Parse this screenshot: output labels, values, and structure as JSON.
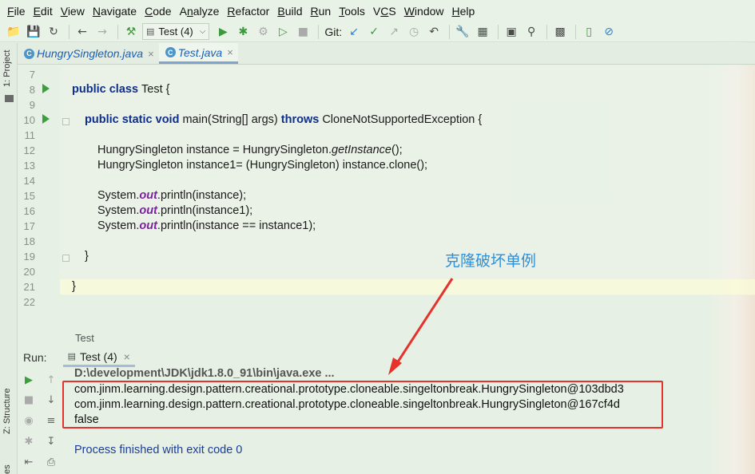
{
  "menu": {
    "items": [
      {
        "label": "File",
        "mnemonic_index": 0
      },
      {
        "label": "Edit",
        "mnemonic_index": 0
      },
      {
        "label": "View",
        "mnemonic_index": 0
      },
      {
        "label": "Navigate",
        "mnemonic_index": 0
      },
      {
        "label": "Code",
        "mnemonic_index": 0
      },
      {
        "label": "Analyze",
        "mnemonic_index": 1
      },
      {
        "label": "Refactor",
        "mnemonic_index": 0
      },
      {
        "label": "Build",
        "mnemonic_index": 0
      },
      {
        "label": "Run",
        "mnemonic_index": 0
      },
      {
        "label": "Tools",
        "mnemonic_index": 0
      },
      {
        "label": "VCS",
        "mnemonic_index": 1
      },
      {
        "label": "Window",
        "mnemonic_index": 0
      },
      {
        "label": "Help",
        "mnemonic_index": 0
      }
    ]
  },
  "toolbar": {
    "run_config": "Test (4)",
    "git_label": "Git:"
  },
  "side_tabs": {
    "project": "1: Project",
    "structure": "Z: Structure",
    "favorites": "es"
  },
  "editor_tabs": [
    {
      "file": "HungrySingleton.java",
      "icon": "C",
      "active": false
    },
    {
      "file": "Test.java",
      "icon": "C",
      "active": true
    }
  ],
  "editor": {
    "line_numbers": [
      "7",
      "8",
      "9",
      "10",
      "11",
      "12",
      "13",
      "14",
      "15",
      "16",
      "17",
      "18",
      "19",
      "20",
      "21",
      "22"
    ],
    "lines": {
      "l8_a": "public class ",
      "l8_b": "Test {",
      "l10_a": "public static void ",
      "l10_b": "main(String[] args) ",
      "l10_c": "throws ",
      "l10_d": "CloneNotSupportedException {",
      "l12_a": "HungrySingleton instance = HungrySingleton.",
      "l12_b": "getInstance",
      "l12_c": "();",
      "l13": "HungrySingleton instance1= (HungrySingleton) instance.clone();",
      "l15_a": "System.",
      "l15_b": "out",
      "l15_c": ".println(instance);",
      "l16_a": "System.",
      "l16_b": "out",
      "l16_c": ".println(instance1);",
      "l17_a": "System.",
      "l17_b": "out",
      "l17_c": ".println(instance == instance1);",
      "l19": "}",
      "l21": "}"
    },
    "annotation": "克隆破坏单例",
    "breadcrumb": "Test"
  },
  "run_panel": {
    "label": "Run:",
    "tab": "Test (4)",
    "command": "D:\\development\\JDK\\jdk1.8.0_91\\bin\\java.exe ...",
    "output": [
      "com.jinm.learning.design.pattern.creational.prototype.cloneable.singeltonbreak.HungrySingleton@103dbd3",
      "com.jinm.learning.design.pattern.creational.prototype.cloneable.singeltonbreak.HungrySingleton@167cf4d",
      "false"
    ],
    "exit_message": "Process finished with exit code 0"
  },
  "colors": {
    "keyword": "#0f2f8c",
    "static_field": "#7b1fa2",
    "annotation": "#2f8fd8",
    "highlight_box": "#e5322d",
    "exit_text": "#1b3d9a"
  }
}
